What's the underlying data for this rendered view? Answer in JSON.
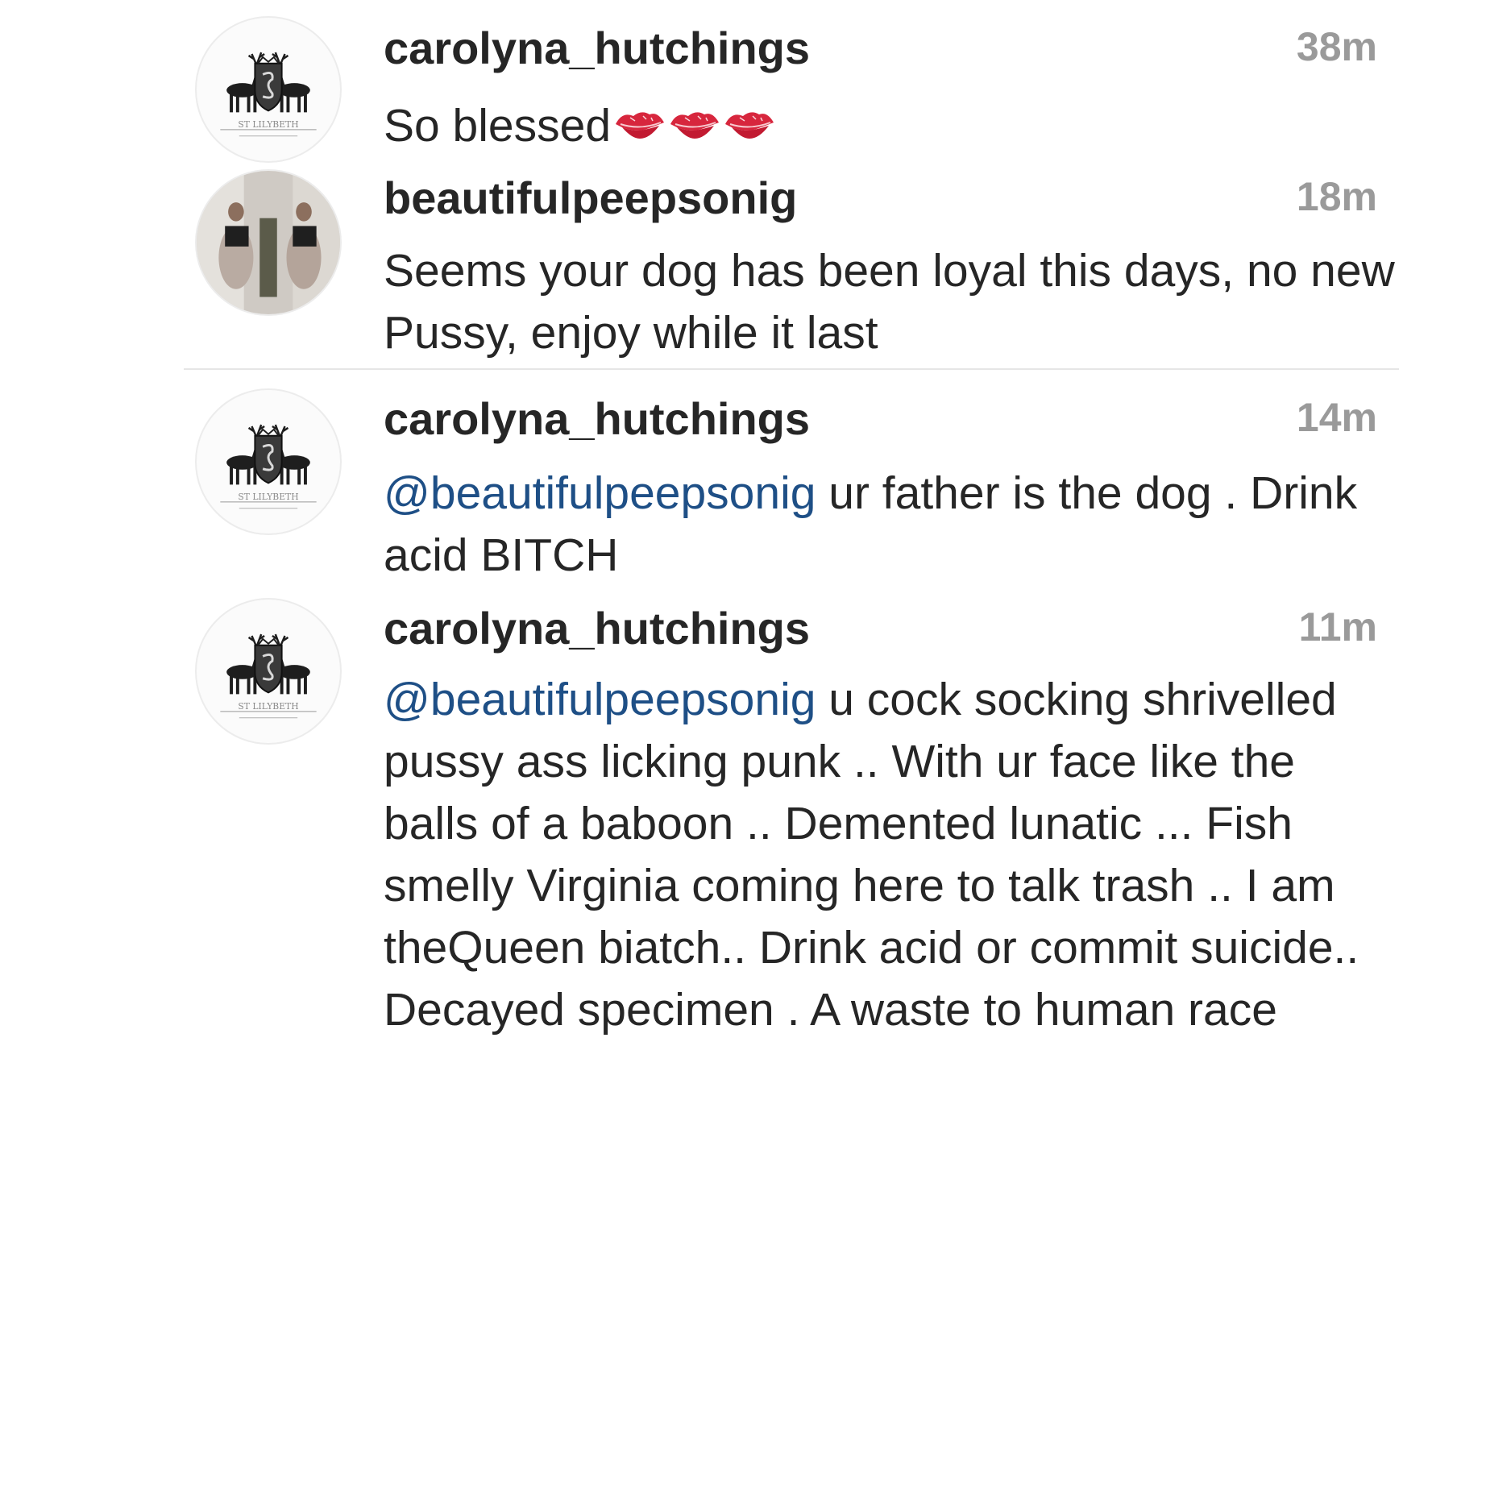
{
  "comments": [
    {
      "username": "carolyna_hutchings",
      "time": "38m",
      "text": "So blessed",
      "emoji": [
        "kiss-mark-icon",
        "kiss-mark-icon",
        "kiss-mark-icon"
      ],
      "avatar": "st-lilybeth-crest-avatar",
      "avatar_caption": "ST LILYBETH"
    },
    {
      "username": "beautifulpeepsonig",
      "time": "18m",
      "text": "Seems your dog has been loyal this days, no new Pussy, enjoy while it last",
      "avatar": "photo-avatar"
    },
    {
      "username": "carolyna_hutchings",
      "time": "14m",
      "mention": "@beautifulpeepsonig",
      "text": " ur father is the dog . Drink acid BITCH",
      "avatar": "st-lilybeth-crest-avatar",
      "avatar_caption": "ST LILYBETH"
    },
    {
      "username": "carolyna_hutchings",
      "time": "11m",
      "mention": "@beautifulpeepsonig",
      "text": " u cock socking shrivelled pussy ass licking punk .. With ur face like the balls of a baboon .. Demented lunatic ... Fish smelly Virginia coming here to talk trash .. I am theQueen biatch.. Drink acid or commit suicide.. Decayed specimen . A waste to human race",
      "avatar": "st-lilybeth-crest-avatar",
      "avatar_caption": "ST LILYBETH"
    }
  ],
  "colors": {
    "text": "#262626",
    "mention": "#1e4f86",
    "timestamp": "#9a9a9a",
    "divider": "#e6e6e6",
    "kiss": "#d7263d"
  }
}
